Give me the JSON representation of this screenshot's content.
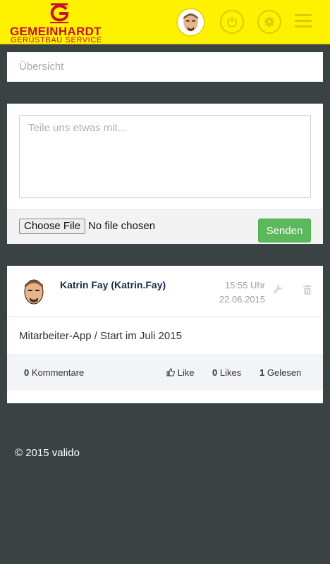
{
  "header": {
    "brand_name": "GEMEINHARDT",
    "brand_tagline": "GERÜSTBAU SERVICE",
    "icons": {
      "logo": "gemeinhardt-g-logo",
      "avatar": "user-avatar",
      "power": "power-icon",
      "settings": "gear-icon",
      "menu": "hamburger-icon"
    },
    "colors": {
      "bar": "#fff200",
      "brand": "#c8102e"
    }
  },
  "overview": {
    "label": "Übersicht"
  },
  "composer": {
    "placeholder": "Teile uns etwas mit...",
    "choose_file_label": "Choose File",
    "no_file_label": "No file chosen",
    "send_label": "Senden",
    "send_color": "#5cb85c"
  },
  "post": {
    "author": "Katrin Fay (Katrin.Fay)",
    "time": "15:55 Uhr",
    "date": "22.06.2015",
    "body": "Mitarbeiter-App / Start im Juli 2015",
    "comments_count": "0",
    "comments_label": "Kommentare",
    "like_label": "Like",
    "likes_count": "0",
    "likes_label": "Likes",
    "read_count": "1",
    "read_label": "Gelesen",
    "icons": {
      "edit": "wrench-icon",
      "delete": "trash-icon",
      "like": "thumbs-up-icon"
    }
  },
  "footer": {
    "copyright": "© 2015 valido"
  }
}
